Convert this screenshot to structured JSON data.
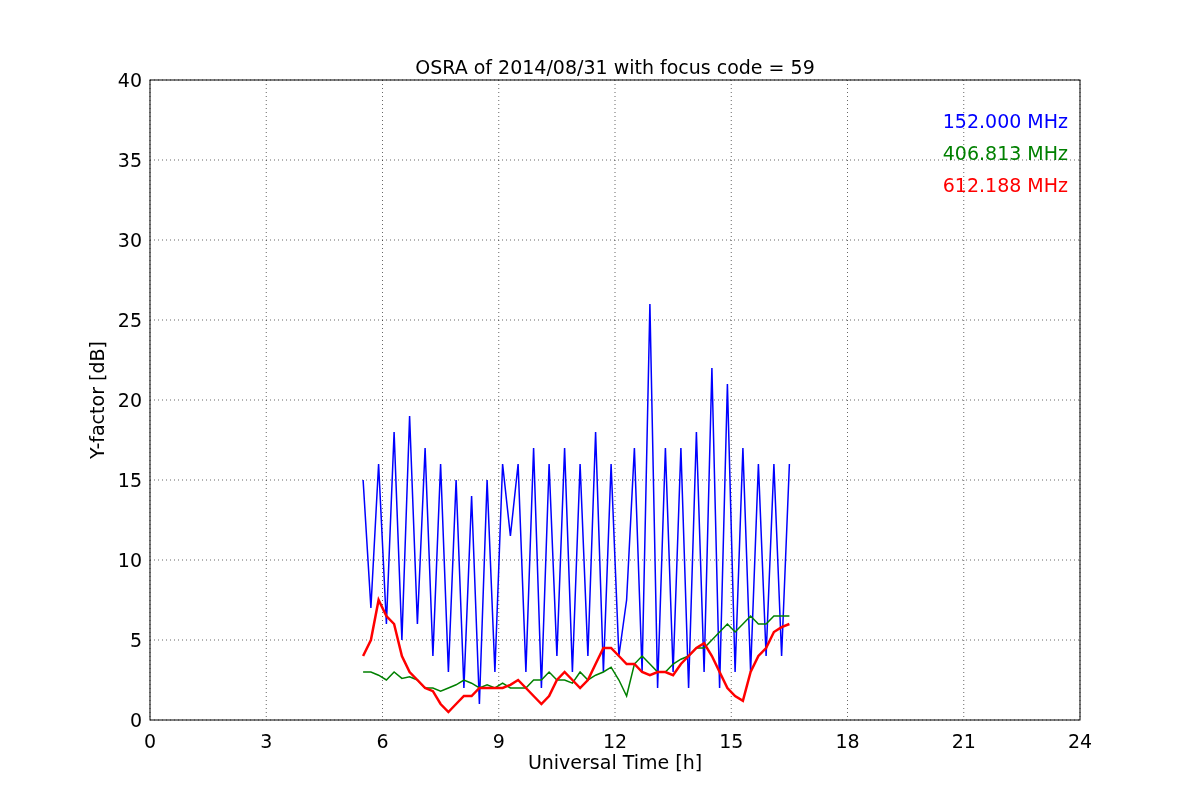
{
  "chart_data": {
    "type": "line",
    "title": "OSRA of 2014/08/31 with focus code = 59",
    "xlabel": "Universal Time [h]",
    "ylabel": "Y-factor [dB]",
    "x": [
      5.5,
      5.7,
      5.9,
      6.1,
      6.3,
      6.5,
      6.7,
      6.9,
      7.1,
      7.3,
      7.5,
      7.7,
      7.9,
      8.1,
      8.3,
      8.5,
      8.7,
      8.9,
      9.1,
      9.3,
      9.5,
      9.7,
      9.9,
      10.1,
      10.3,
      10.5,
      10.7,
      10.9,
      11.1,
      11.3,
      11.5,
      11.7,
      11.9,
      12.1,
      12.3,
      12.5,
      12.7,
      12.9,
      13.1,
      13.3,
      13.5,
      13.7,
      13.9,
      14.1,
      14.3,
      14.5,
      14.7,
      14.9,
      15.1,
      15.3,
      15.5,
      15.7,
      15.9,
      16.1,
      16.3,
      16.5
    ],
    "series": [
      {
        "name": "152.000 MHz",
        "color": "#0000ff",
        "values": [
          15,
          7,
          16,
          6,
          18,
          5,
          19,
          6,
          17,
          4,
          16,
          3,
          15,
          2,
          14,
          1,
          15,
          3,
          16,
          11.5,
          16,
          3,
          17,
          2,
          16,
          4,
          17,
          3,
          16,
          4,
          18,
          3,
          16,
          4,
          7.5,
          17,
          3,
          26,
          2,
          17,
          3,
          17,
          2,
          18,
          3,
          22,
          2,
          21,
          3,
          17,
          3,
          16,
          4,
          16,
          4,
          16
        ]
      },
      {
        "name": "406.813 MHz",
        "color": "#008000",
        "values": [
          3,
          3,
          2.8,
          2.5,
          3,
          2.6,
          2.7,
          2.5,
          2,
          2,
          1.8,
          2,
          2.2,
          2.5,
          2.3,
          2,
          2.2,
          2,
          2.3,
          2,
          2,
          2,
          2.5,
          2.5,
          3,
          2.5,
          2.5,
          2.3,
          3,
          2.5,
          2.8,
          3,
          3.3,
          2.5,
          1.5,
          3.5,
          4,
          3.5,
          3,
          3,
          3.5,
          3.8,
          4,
          4.5,
          4.5,
          5,
          5.5,
          6,
          5.5,
          6,
          6.5,
          6,
          6,
          6.5,
          6.5,
          6.5
        ]
      },
      {
        "name": "612.188 MHz",
        "color": "#ff0000",
        "values": [
          4,
          5,
          7.5,
          6.5,
          6,
          4,
          3,
          2.5,
          2,
          1.8,
          1,
          0.5,
          1,
          1.5,
          1.5,
          2,
          2,
          2,
          2,
          2.2,
          2.5,
          2,
          1.5,
          1,
          1.5,
          2.5,
          3,
          2.5,
          2,
          2.5,
          3.5,
          4.5,
          4.5,
          4,
          3.5,
          3.5,
          3,
          2.8,
          3,
          3,
          2.8,
          3.5,
          4,
          4.5,
          4.8,
          4,
          3,
          2,
          1.5,
          1.2,
          3,
          4,
          4.5,
          5.5,
          5.8,
          6
        ]
      }
    ],
    "xlim": [
      0,
      24
    ],
    "ylim": [
      0,
      40
    ],
    "xticks": [
      0,
      3,
      6,
      9,
      12,
      15,
      18,
      21,
      24
    ],
    "yticks": [
      0,
      5,
      10,
      15,
      20,
      25,
      30,
      35,
      40
    ],
    "grid": true
  }
}
